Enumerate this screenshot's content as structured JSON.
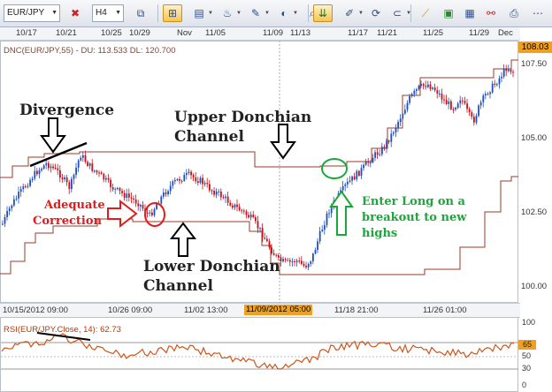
{
  "toolbar": {
    "symbol": "EUR/JPY",
    "timeframe": "H4",
    "buttons": [
      "chart-type-icon",
      "crosshair-icon",
      "properties-icon",
      "indicators-icon",
      "drawing-icon",
      "zoom-icon",
      "color-icon",
      "hand-icon",
      "magnet-icon",
      "export-icon",
      "ruler-icon",
      "image-icon",
      "picture-icon",
      "rsi-icon",
      "print-icon"
    ]
  },
  "time_axis_top": [
    "10/17",
    "10/21",
    "10/25",
    "10/29",
    "Nov",
    "11/05",
    "11/09",
    "11/13",
    "11/17",
    "11/21",
    "11/25",
    "11/29",
    "Dec"
  ],
  "indicator_label": "DNC(EUR/JPY,55) - DU: 113.533  DL: 120.700",
  "price_axis": {
    "current": "108.03",
    "ticks": [
      "107.50",
      "105.00",
      "102.50",
      "100.00"
    ]
  },
  "time_axis_bottom": [
    "10/15/2012 09:00",
    "10/26 09:00",
    "11/02 13:00",
    "11/09/2012 05:00",
    "11/18 21:00",
    "11/26 01:00"
  ],
  "rsi": {
    "label": "RSI(EUR/JPY.Close, 14): 62.73",
    "ticks": [
      "100",
      "70",
      "50",
      "30",
      "0"
    ],
    "current_badge": "65"
  },
  "annotations": {
    "divergence": "Divergence",
    "upper_1": "Upper Donchian",
    "upper_2": "Channel",
    "adequate_1": "Adequate",
    "adequate_2": "Correction",
    "lower_1": "Lower Donchian",
    "lower_2": "Channel",
    "enter_1": "Enter Long on a",
    "enter_2": "breakout to new",
    "enter_3": "highs"
  },
  "colors": {
    "up_candle": "#1f4fbf",
    "down_candle": "#c8101a",
    "channel": "#9b3a2a",
    "rsi_line": "#d0541a",
    "annotation_red": "#e01c1c",
    "annotation_green": "#1aa83a",
    "highlight": "#f0a020"
  }
}
